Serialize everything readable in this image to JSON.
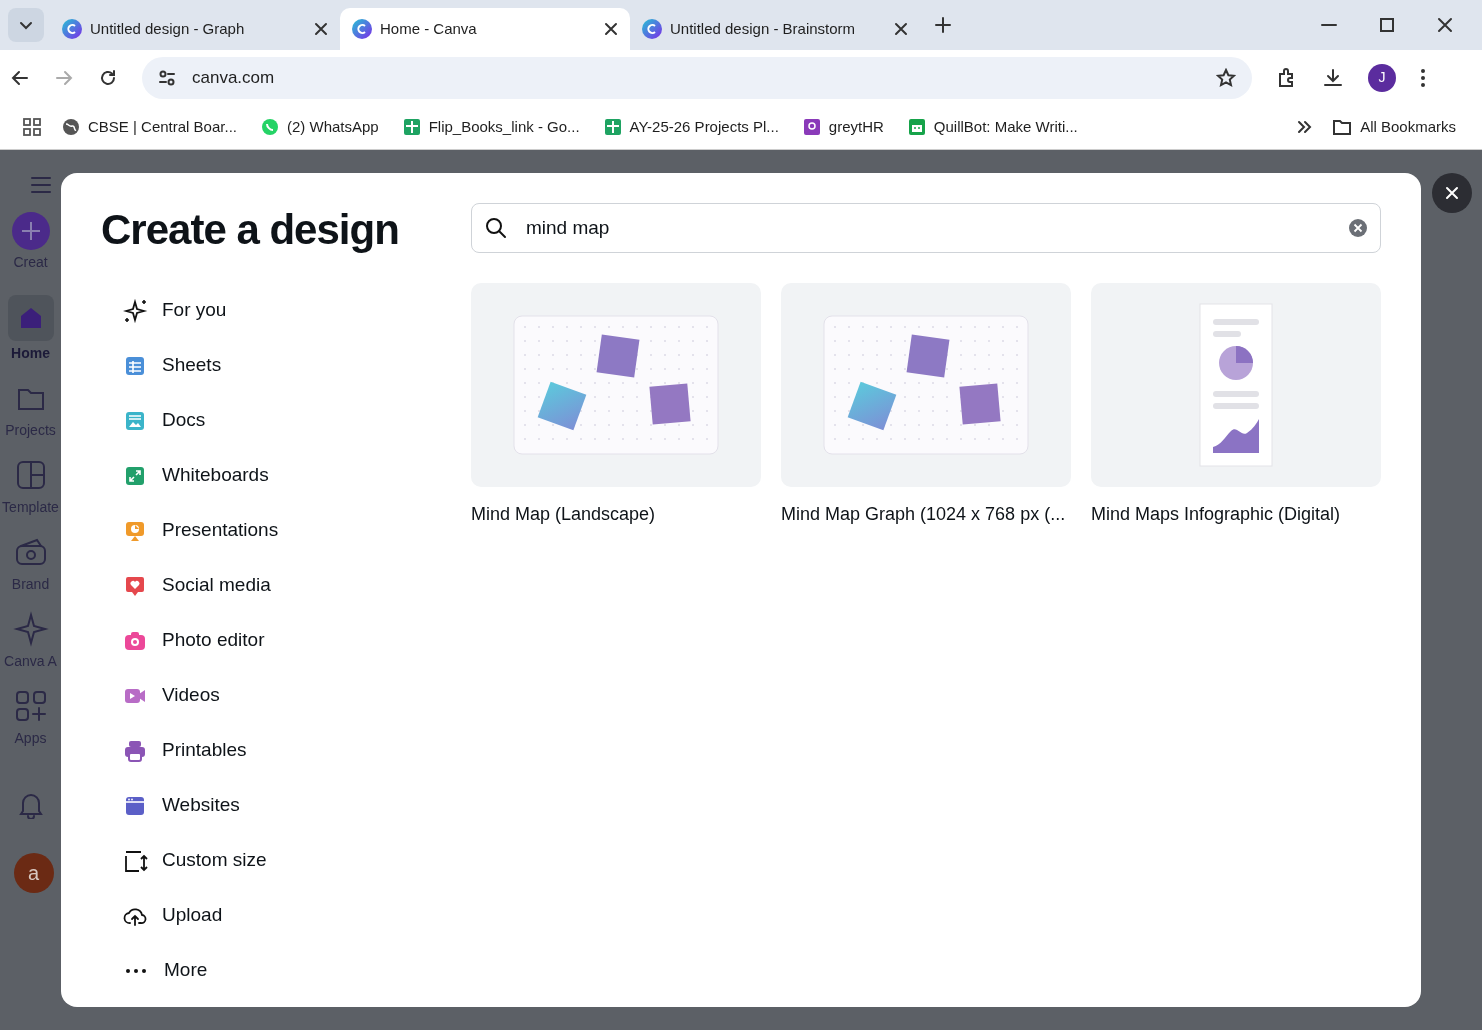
{
  "browser": {
    "tabs": [
      {
        "title": "Untitled design - Graph",
        "selected": false
      },
      {
        "title": "Home - Canva",
        "selected": true
      },
      {
        "title": "Untitled design - Brainstorm",
        "selected": false
      }
    ],
    "address": "canva.com",
    "bookmarks": [
      "CBSE | Central Boar...",
      "(2) WhatsApp",
      "Flip_Books_link - Go...",
      "AY-25-26 Projects Pl...",
      "greytHR",
      "QuillBot: Make Writi..."
    ],
    "all_bookmarks": "All Bookmarks",
    "profile_initial": "J"
  },
  "sidebar": {
    "items": [
      {
        "label": "Creat",
        "selected": false
      },
      {
        "label": "Home",
        "selected": true
      },
      {
        "label": "Projects",
        "selected": false
      },
      {
        "label": "Template",
        "selected": false
      },
      {
        "label": "Brand",
        "selected": false
      },
      {
        "label": "Canva A",
        "selected": false
      },
      {
        "label": "Apps",
        "selected": false
      }
    ],
    "avatar_initial": "a"
  },
  "dialog": {
    "title": "Create a design",
    "search": {
      "value": "mind map"
    },
    "categories": [
      {
        "label": "For you"
      },
      {
        "label": "Sheets"
      },
      {
        "label": "Docs"
      },
      {
        "label": "Whiteboards"
      },
      {
        "label": "Presentations"
      },
      {
        "label": "Social media"
      },
      {
        "label": "Photo editor"
      },
      {
        "label": "Videos"
      },
      {
        "label": "Printables"
      },
      {
        "label": "Websites"
      },
      {
        "label": "Custom size"
      },
      {
        "label": "Upload"
      },
      {
        "label": "More"
      }
    ],
    "results": [
      {
        "title": "Mind Map (Landscape)",
        "kind": "mindmap"
      },
      {
        "title": "Mind Map Graph (1024 x 768 px (...",
        "kind": "mindmap"
      },
      {
        "title": "Mind Maps Infographic (Digital)",
        "kind": "infographic"
      }
    ]
  }
}
